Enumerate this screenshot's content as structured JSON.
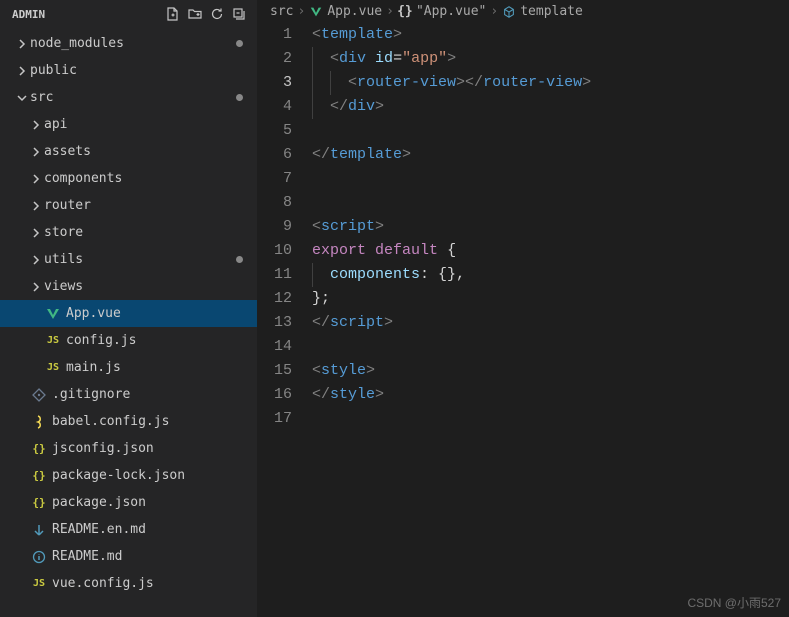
{
  "sidebar": {
    "title": "ADMIN",
    "tree": [
      {
        "depth": 0,
        "expand": "closed",
        "icon": null,
        "label": "node_modules",
        "dot": true
      },
      {
        "depth": 0,
        "expand": "closed",
        "icon": null,
        "label": "public"
      },
      {
        "depth": 0,
        "expand": "open",
        "icon": null,
        "label": "src",
        "dot": true
      },
      {
        "depth": 1,
        "expand": "closed",
        "icon": null,
        "label": "api"
      },
      {
        "depth": 1,
        "expand": "closed",
        "icon": null,
        "label": "assets"
      },
      {
        "depth": 1,
        "expand": "closed",
        "icon": null,
        "label": "components"
      },
      {
        "depth": 1,
        "expand": "closed",
        "icon": null,
        "label": "router"
      },
      {
        "depth": 1,
        "expand": "closed",
        "icon": null,
        "label": "store"
      },
      {
        "depth": 1,
        "expand": "closed",
        "icon": null,
        "label": "utils",
        "dot": true
      },
      {
        "depth": 1,
        "expand": "closed",
        "icon": null,
        "label": "views"
      },
      {
        "depth": 1,
        "expand": null,
        "icon": "vue",
        "label": "App.vue",
        "selected": true
      },
      {
        "depth": 1,
        "expand": null,
        "icon": "js",
        "label": "config.js"
      },
      {
        "depth": 1,
        "expand": null,
        "icon": "js",
        "label": "main.js"
      },
      {
        "depth": 0,
        "expand": null,
        "icon": "git",
        "label": ".gitignore"
      },
      {
        "depth": 0,
        "expand": null,
        "icon": "babel",
        "label": "babel.config.js"
      },
      {
        "depth": 0,
        "expand": null,
        "icon": "json",
        "label": "jsconfig.json"
      },
      {
        "depth": 0,
        "expand": null,
        "icon": "json",
        "label": "package-lock.json"
      },
      {
        "depth": 0,
        "expand": null,
        "icon": "json",
        "label": "package.json"
      },
      {
        "depth": 0,
        "expand": null,
        "icon": "md",
        "label": "README.en.md"
      },
      {
        "depth": 0,
        "expand": null,
        "icon": "info",
        "label": "README.md"
      },
      {
        "depth": 0,
        "expand": null,
        "icon": "js",
        "label": "vue.config.js"
      }
    ]
  },
  "breadcrumb": {
    "seg0": "src",
    "seg1": "App.vue",
    "seg2": "\"App.vue\"",
    "seg3": "template"
  },
  "code": {
    "lines": 17,
    "current": 3
  },
  "icons": {
    "js_color": "#cbcb41",
    "json_color": "#cbcb41",
    "vue_color": "#41b883",
    "git_color": "#6b7a8f",
    "babel_color": "#f5da55",
    "md_color": "#519aba",
    "info_color": "#519aba"
  },
  "watermark": "CSDN @小雨527"
}
